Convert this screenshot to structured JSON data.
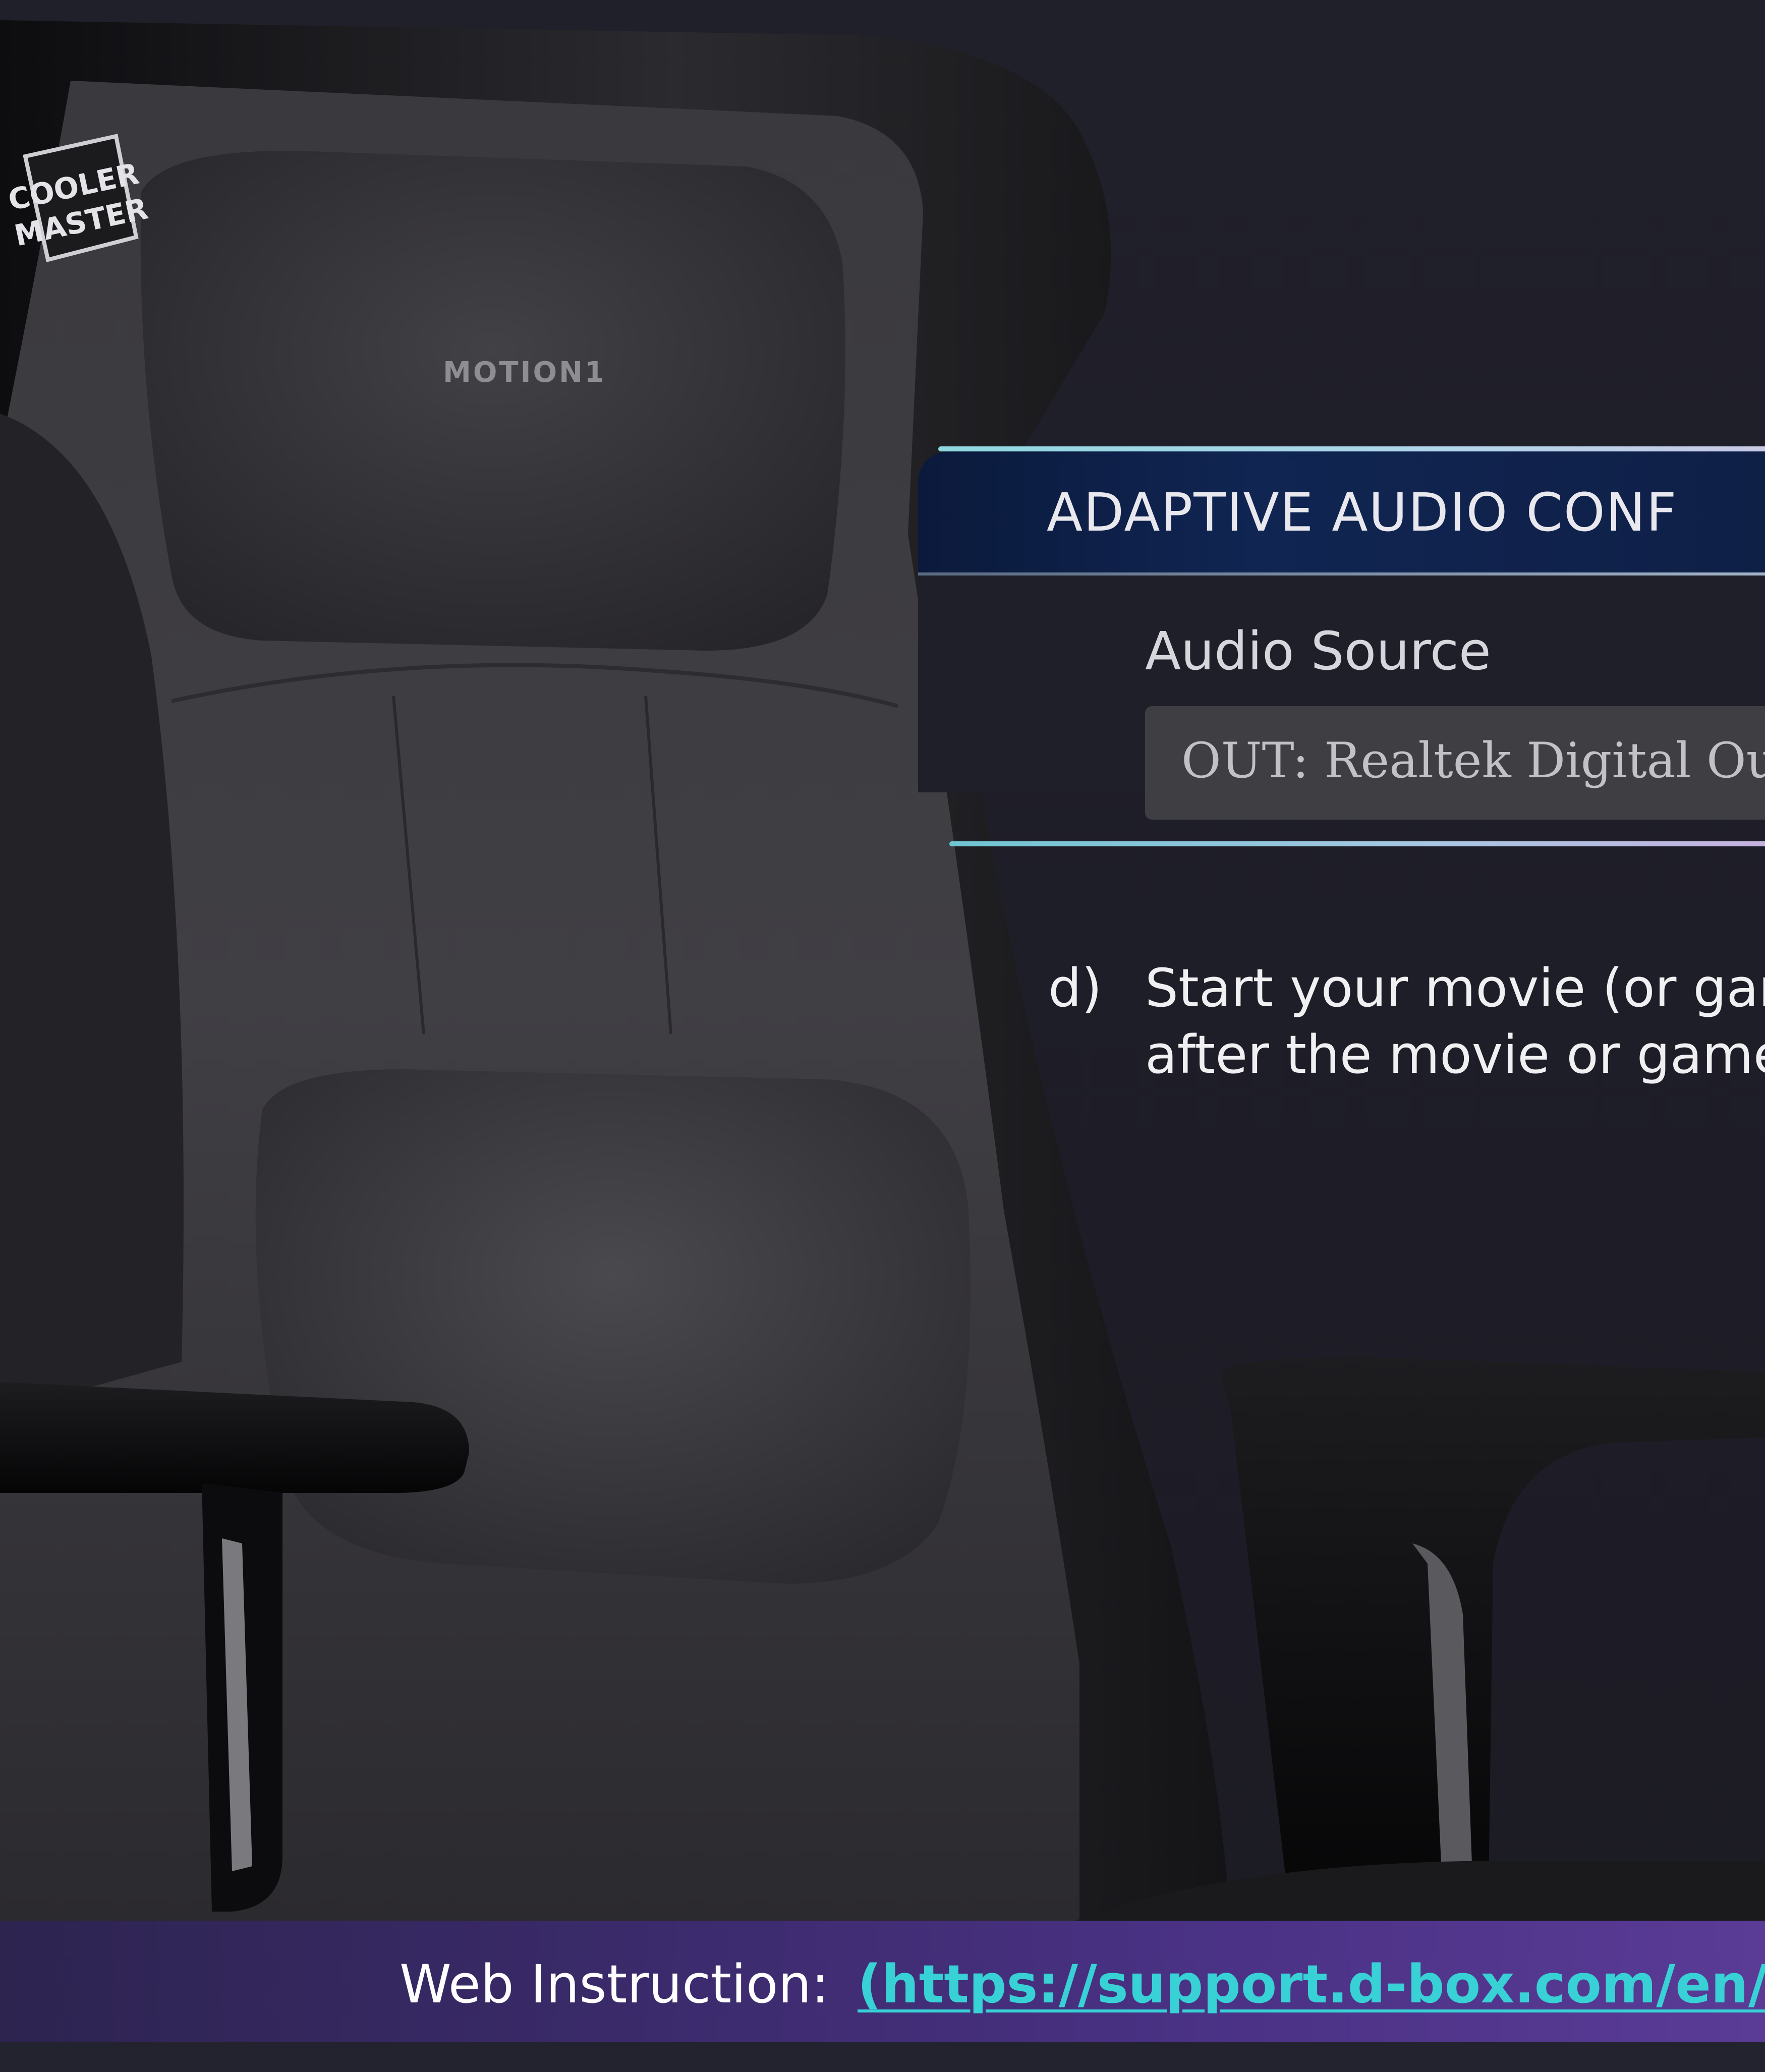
{
  "logo": {
    "line1": "COOLER",
    "line2": "MASTER"
  },
  "headrest_brand": "MOTION1",
  "panel": {
    "title": "ADAPTIVE AUDIO CONF",
    "audio_source_label": "Audio Source",
    "audio_source_value": "OUT: Realtek Digital Output ("
  },
  "step": {
    "marker": "d)",
    "line1": "Start your movie (or gar",
    "line2": "after the movie or game"
  },
  "banner": {
    "label": "Web Instruction: ",
    "link_text": "(https://support.d-box.com/en/k"
  },
  "colors": {
    "background": "#1e1e28",
    "panel_header": "#102552",
    "accent_line": "#8fd8e0",
    "link": "#38d1d6",
    "banner": "#4b3286"
  }
}
